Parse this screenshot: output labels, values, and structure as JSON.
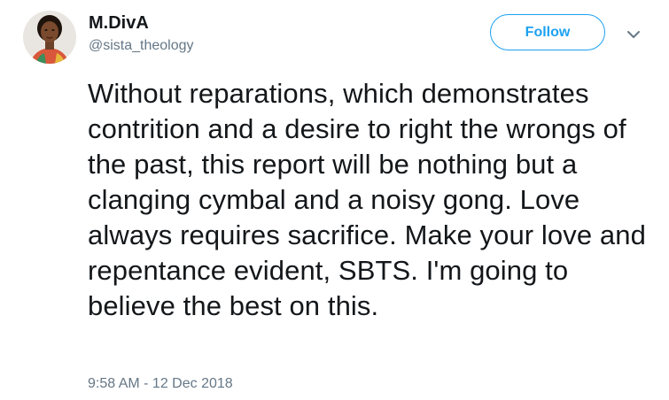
{
  "user": {
    "display_name": "M.DivA",
    "handle": "@sista_theology"
  },
  "actions": {
    "follow_label": "Follow"
  },
  "icons": {
    "avatar": "profile-photo",
    "menu": "chevron-down-icon"
  },
  "tweet": {
    "text": "Without reparations, which demonstrates contrition and a desire to right the wrongs of the past, this report will be nothing but a clanging cymbal and a noisy gong. Love always requires sacrifice. Make your love and repentance evident, SBTS. I'm going to believe the best on this.",
    "timestamp": "9:58 AM - 12 Dec 2018"
  },
  "colors": {
    "accent": "#1da1f2",
    "text": "#14171a",
    "muted": "#657786"
  }
}
